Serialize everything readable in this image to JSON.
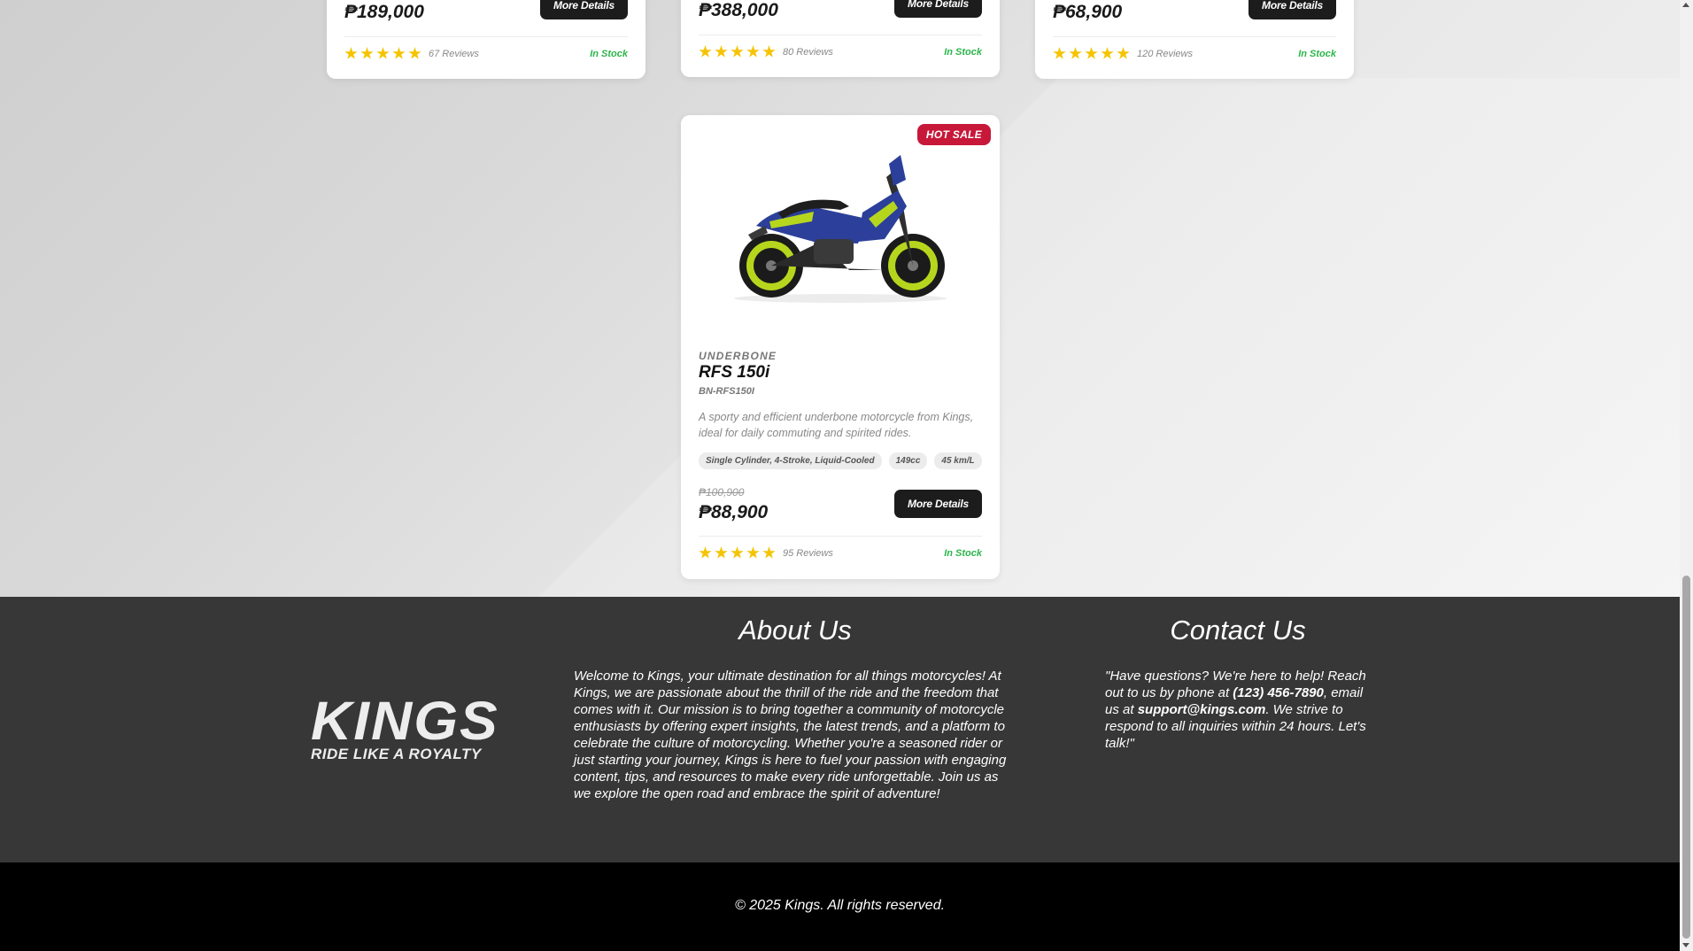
{
  "products_top": [
    {
      "price": "₱189,000",
      "button": "More Details",
      "reviews": "67 Reviews",
      "stock": "In Stock",
      "rating": 5
    },
    {
      "price": "₱388,000",
      "button": "More Details",
      "reviews": "80 Reviews",
      "stock": "In Stock",
      "rating": 5
    },
    {
      "price": "₱68,900",
      "button": "More Details",
      "reviews": "120 Reviews",
      "stock": "In Stock",
      "rating": 5
    }
  ],
  "featured_product": {
    "badge": "HOT SALE",
    "category": "UNDERBONE",
    "name": "RFS 150i",
    "sku": "BN-RFS150I",
    "description": "A sporty and efficient underbone motorcycle from Kings, ideal for daily commuting and spirited rides.",
    "specs": [
      "Single Cylinder, 4-Stroke, Liquid-Cooled",
      "149cc",
      "45 km/L"
    ],
    "old_price": "₱100,900",
    "price": "₱88,900",
    "button": "More Details",
    "reviews": "95 Reviews",
    "stock": "In Stock",
    "rating": 5
  },
  "footer": {
    "logo_text": "KINGS",
    "logo_tagline": "RIDE LIKE A ROYALTY",
    "about_title": "About Us",
    "about_text": "Welcome to Kings, your ultimate destination for all things motorcycles! At Kings, we are passionate about the thrill of the ride and the freedom that comes with it. Our mission is to bring together a community of motorcycle enthusiasts by offering expert insights, the latest trends, and a platform to celebrate the culture of motorcycling. Whether you're a seasoned rider or just starting your journey, Kings is here to fuel your passion with engaging content, tips, and resources to make every ride unforgettable. Join us as we explore the open road and embrace the spirit of adventure!",
    "contact_title": "Contact Us",
    "contact_intro": "\"Have questions? We're here to help! Reach out to us by phone at ",
    "contact_phone": "(123) 456-7890",
    "contact_mid": ", email us at ",
    "contact_email": "support@kings.com",
    "contact_outro": ". We strive to respond to all inquiries within 24 hours. Let's talk!\"",
    "copyright": "© 2025 Kings. All rights reserved."
  },
  "colors": {
    "accent_badge": "#c7183a",
    "in_stock": "#2bb54a",
    "star": "#f5c400",
    "footer_bg": "#373737",
    "bottom_bg": "#000000"
  }
}
